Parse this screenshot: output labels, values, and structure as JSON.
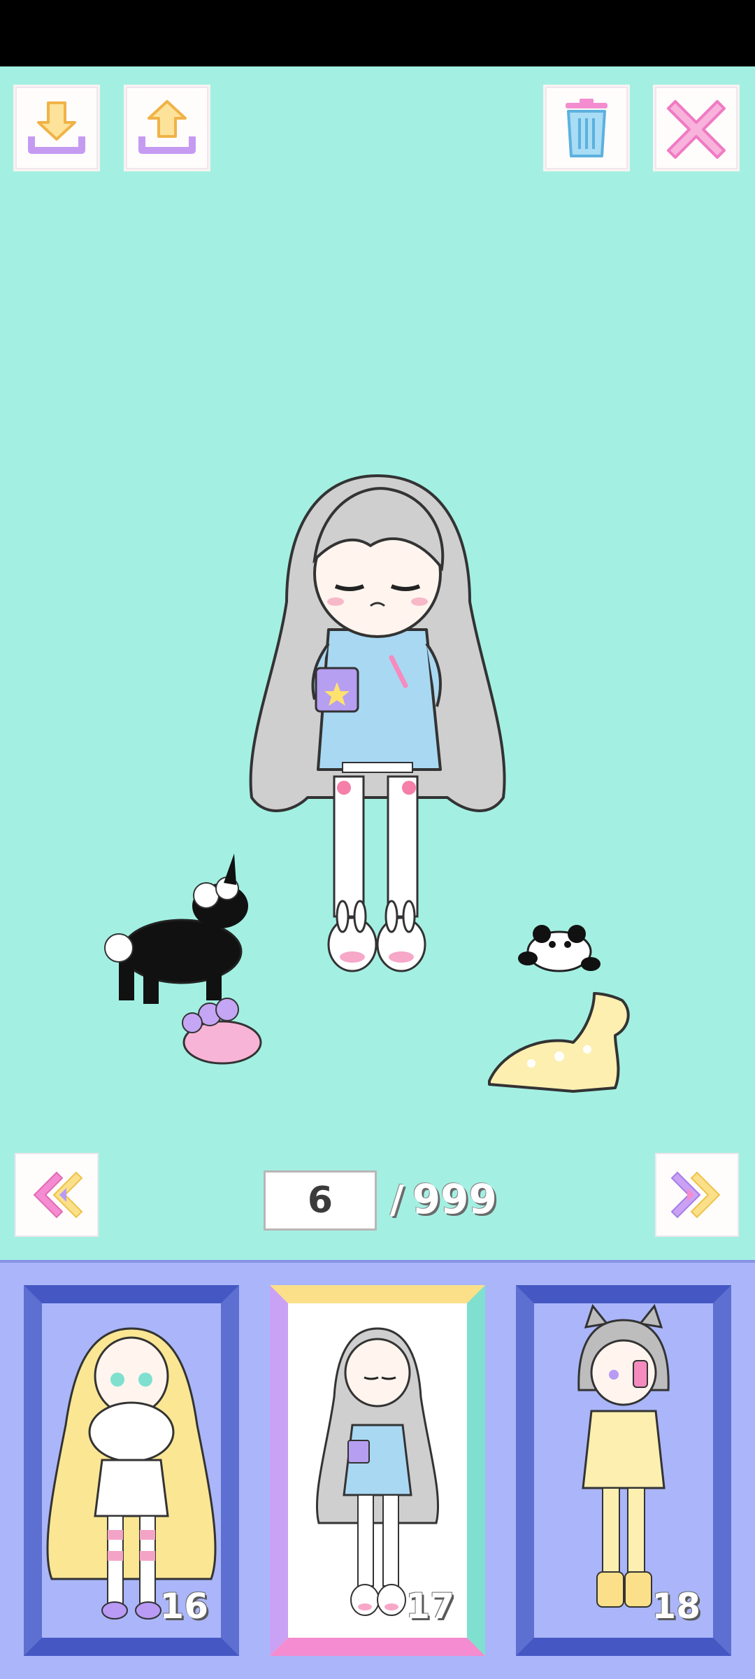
{
  "toolbar": {
    "import_icon": "download-arrow-icon",
    "export_icon": "upload-arrow-icon",
    "delete_icon": "trash-icon",
    "close_icon": "close-x-icon"
  },
  "pager": {
    "current_page": "6",
    "separator": "/",
    "total_pages": "999",
    "prev_icon": "double-chevron-left-icon",
    "next_icon": "double-chevron-right-icon"
  },
  "slots": [
    {
      "number": "16",
      "character": "blonde-girl-with-bouquet",
      "selected": false
    },
    {
      "number": "17",
      "character": "gray-hair-girl-pajamas",
      "selected": true
    },
    {
      "number": "18",
      "character": "cat-ear-boy-yellow",
      "selected": false
    }
  ],
  "colors": {
    "background": "#a3f0e3",
    "panel": "#aab6f9",
    "frame_blue": "#5d6fd0",
    "accent_pink": "#f58bd0",
    "accent_yellow": "#fbe089",
    "accent_purple": "#c9a2f5"
  }
}
